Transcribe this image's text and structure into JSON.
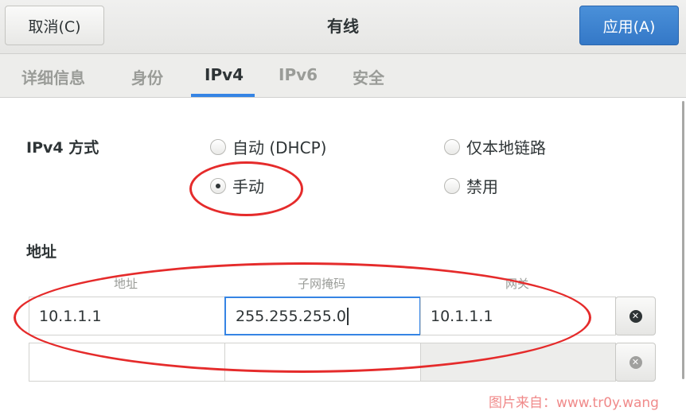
{
  "header": {
    "cancel_label": "取消(C)",
    "title": "有线",
    "apply_label": "应用(A)",
    "apply_color": "#3478c7"
  },
  "tabs": [
    {
      "label": "详细信息",
      "active": false
    },
    {
      "label": "身份",
      "active": false
    },
    {
      "label": "IPv4",
      "active": true
    },
    {
      "label": "IPv6",
      "active": false
    },
    {
      "label": "安全",
      "active": false
    }
  ],
  "ipv4": {
    "method_label": "IPv4 方式",
    "options": {
      "auto": {
        "label": "自动 (DHCP)",
        "selected": false
      },
      "link_local": {
        "label": "仅本地链路",
        "selected": false
      },
      "manual": {
        "label": "手动",
        "selected": true
      },
      "disabled": {
        "label": "禁用",
        "selected": false
      }
    }
  },
  "addresses": {
    "section_label": "地址",
    "columns": [
      "地址",
      "子网掩码",
      "网关"
    ],
    "rows": [
      {
        "address": "10.1.1.1",
        "netmask": "255.255.255.0",
        "gateway": "10.1.1.1"
      },
      {
        "address": "",
        "netmask": "",
        "gateway": ""
      }
    ]
  },
  "watermark": "图片来自：www.tr0y.wang",
  "icons": {
    "delete": "delete-circle-icon",
    "radio": "radio-icon"
  },
  "colors": {
    "accent": "#3584e4",
    "annotation": "#e52b2b"
  }
}
